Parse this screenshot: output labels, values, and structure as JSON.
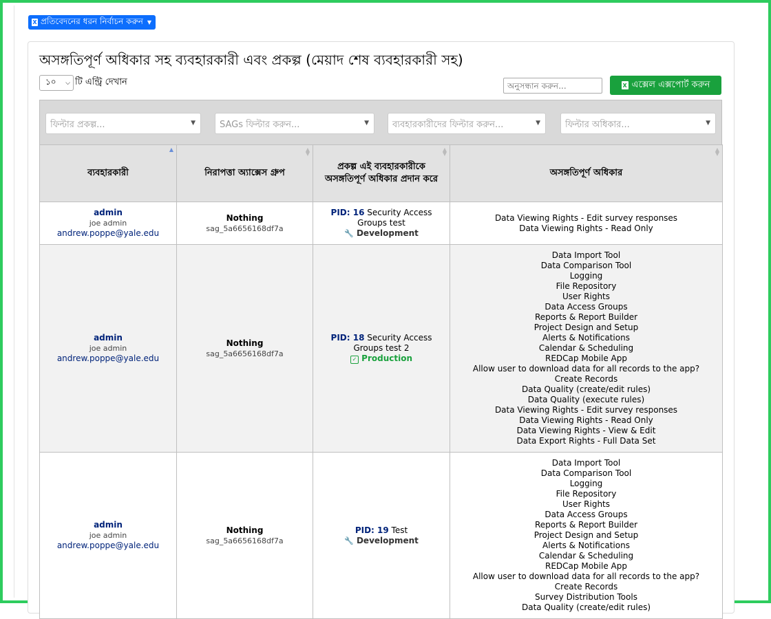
{
  "report_type_button": {
    "label": "প্রতিবেদনের ধরন নির্বাচন করুন",
    "icon": "excel-file-icon"
  },
  "page_title": "অসঙ্গতিপূর্ণ অধিকার সহ ব্যবহারকারী এবং প্রকল্প (মেয়াদ শেষ ব্যবহারকারী সহ)",
  "length": {
    "value": "১০",
    "label": "টি এন্ট্রি দেখান"
  },
  "search": {
    "placeholder": "অনুসন্ধান করুন..."
  },
  "excel_export": {
    "label": "এক্সেল এক্সপোর্ট করুন",
    "icon": "excel-file-icon"
  },
  "filters": {
    "project": "ফিল্টার প্রকল্প...",
    "sags": "SAGs ফিল্টার করুন...",
    "users": "ব্যবহারকারীদের ফিল্টার করুন...",
    "rights": "ফিল্টার অধিকার..."
  },
  "columns": {
    "user": "ব্যবহারকারী",
    "sag": "নিরাপত্তা অ্যাক্সেস গ্রুপ",
    "project": "প্রকল্প এই ব্যবহারকারীকে অসঙ্গতিপূর্ণ অধিকার প্রদান করে",
    "rights": "অসঙ্গতিপূর্ণ অধিকার"
  },
  "rows": [
    {
      "username": "admin",
      "fullname": "joe admin",
      "email": "andrew.poppe@yale.edu",
      "sag_name": "Nothing",
      "sag_id": "sag_5a6656168df7a",
      "pid_label": "PID: 16",
      "project_name": "Security Access Groups test",
      "status": "Development",
      "rights": [
        "Data Viewing Rights - Edit survey responses",
        "Data Viewing Rights - Read Only"
      ]
    },
    {
      "username": "admin",
      "fullname": "joe admin",
      "email": "andrew.poppe@yale.edu",
      "sag_name": "Nothing",
      "sag_id": "sag_5a6656168df7a",
      "pid_label": "PID: 18",
      "project_name": "Security Access Groups test 2",
      "status": "Production",
      "rights": [
        "Data Import Tool",
        "Data Comparison Tool",
        "Logging",
        "File Repository",
        "User Rights",
        "Data Access Groups",
        "Reports & Report Builder",
        "Project Design and Setup",
        "Alerts & Notifications",
        "Calendar & Scheduling",
        "REDCap Mobile App",
        "Allow user to download data for all records to the app?",
        "Create Records",
        "Data Quality (create/edit rules)",
        "Data Quality (execute rules)",
        "Data Viewing Rights - Edit survey responses",
        "Data Viewing Rights - Read Only",
        "Data Viewing Rights - View & Edit",
        "Data Export Rights - Full Data Set"
      ]
    },
    {
      "username": "admin",
      "fullname": "joe admin",
      "email": "andrew.poppe@yale.edu",
      "sag_name": "Nothing",
      "sag_id": "sag_5a6656168df7a",
      "pid_label": "PID: 19",
      "project_name": "Test",
      "status": "Development",
      "rights": [
        "Data Import Tool",
        "Data Comparison Tool",
        "Logging",
        "File Repository",
        "User Rights",
        "Data Access Groups",
        "Reports & Report Builder",
        "Project Design and Setup",
        "Alerts & Notifications",
        "Calendar & Scheduling",
        "REDCap Mobile App",
        "Allow user to download data for all records to the app?",
        "Create Records",
        "Survey Distribution Tools",
        "Data Quality (create/edit rules)"
      ]
    }
  ]
}
